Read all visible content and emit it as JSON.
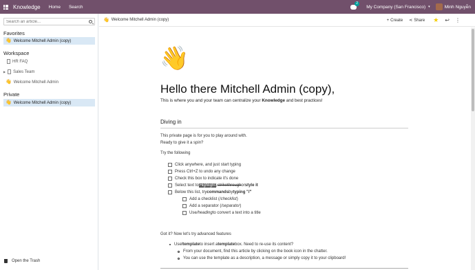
{
  "navbar": {
    "app_name": "Knowledge",
    "links": [
      "Home",
      "Search"
    ],
    "chat_badge": "2",
    "company": "My Company (San Francisco)",
    "user_name": "Minh Nguyễn"
  },
  "sidebar": {
    "search_placeholder": "Search an article...",
    "favorites_title": "Favorites",
    "favorites": [
      "Welcome Mitchell Admin (copy)"
    ],
    "workspace_title": "Workspace",
    "workspace": [
      "HR FAQ",
      "Sales Team",
      "Welcome Mitchell Admin"
    ],
    "private_title": "Private",
    "private": [
      "Welcome Mitchell Admin (copy)"
    ],
    "trash_label": "Open the Trash"
  },
  "topbar": {
    "breadcrumb": "Welcome Mitchell Admin (copy)",
    "create_label": "Create",
    "share_label": "Share"
  },
  "article": {
    "title": "Hello there Mitchell Admin (copy),",
    "lead_pre": "This is where you and your team can centralize your ",
    "lead_bold1": "Knowledge",
    "lead_mid": " and best practices!",
    "section_title": "Diving in",
    "p1": "This private page is for you to play around with.",
    "p2": "Ready to give it a spin?",
    "p3": "Try the following",
    "checklist": [
      "Click anywhere, and just start typing",
      "Press Ctrl+Z to undo any change",
      "Check this box to indicate it's done"
    ],
    "select_pre": "Select text to ",
    "select_hl": "Highlight",
    "select_mid": ", ",
    "select_strike": "strikethrough",
    "select_or": " or ",
    "select_style": "style it",
    "below_pre": "Below this list, try ",
    "below_bold": "commands",
    "below_mid": " by ",
    "below_typing": "typing \"/\"",
    "sub_checklist": [
      [
        "Add a checklist (",
        "/checklist",
        ")"
      ],
      [
        "Add a separator (",
        "/separator",
        ")"
      ],
      [
        "Use ",
        "/heading",
        " to convert a text into a title"
      ]
    ],
    "advanced": "Got it? Now let's try advanced features",
    "bullet_pre": "Use ",
    "bullet_cmd": "/template",
    "bullet_mid": " to insert a ",
    "bullet_bold": "template",
    "bullet_post": " box. Need to re-use its content?",
    "sub_bullets": [
      "From your document, find this article by clicking on the book icon in the chatter.",
      "You can use the template as a description, a message or simply copy it to your clipboard!"
    ]
  }
}
